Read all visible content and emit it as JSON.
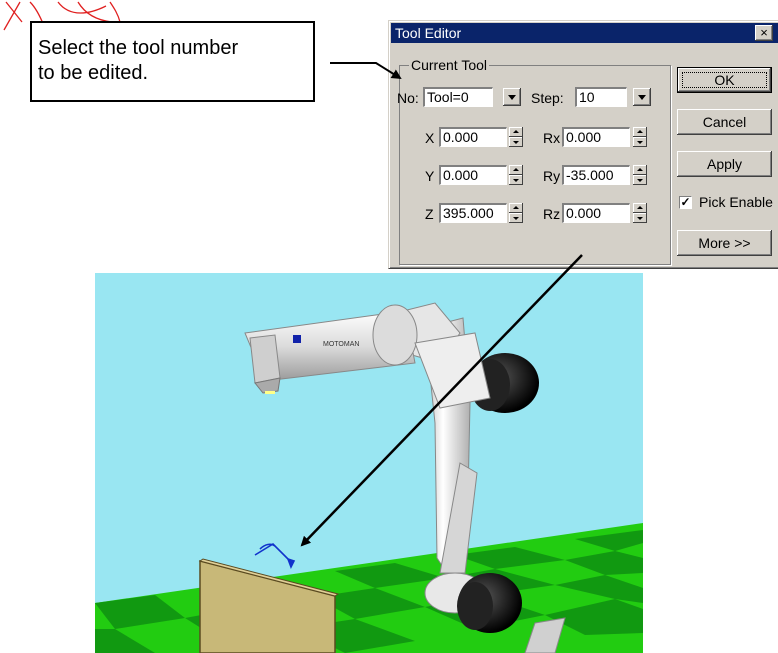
{
  "callout": {
    "line1": "Select the tool number",
    "line2": "to be edited."
  },
  "dialog": {
    "title": "Tool Editor",
    "close_glyph": "×",
    "group_label": "Current Tool",
    "no_label": "No:",
    "tool_value": "Tool=0",
    "step_label": "Step:",
    "step_value": "10",
    "fields": {
      "x": {
        "label": "X",
        "value": "0.000"
      },
      "y": {
        "label": "Y",
        "value": "0.000"
      },
      "z": {
        "label": "Z",
        "value": "395.000"
      },
      "rx": {
        "label": "Rx",
        "value": "0.000"
      },
      "ry": {
        "label": "Ry",
        "value": "-35.000"
      },
      "rz": {
        "label": "Rz",
        "value": "0.000"
      }
    },
    "buttons": {
      "ok": "OK",
      "cancel": "Cancel",
      "apply": "Apply",
      "more": "More >>"
    },
    "pick_enable": {
      "label": "Pick Enable",
      "checked": true
    }
  },
  "colors": {
    "title_bar": "#0a246a",
    "sky": "#99e6f2",
    "floor_green_a": "#33dd11",
    "floor_green_b": "#119911",
    "robot_white": "#e8e8e8",
    "motor_black": "#111111",
    "workpiece": "#c8b878",
    "tool_frame": "#1133cc",
    "stamp_red": "#e02020"
  }
}
